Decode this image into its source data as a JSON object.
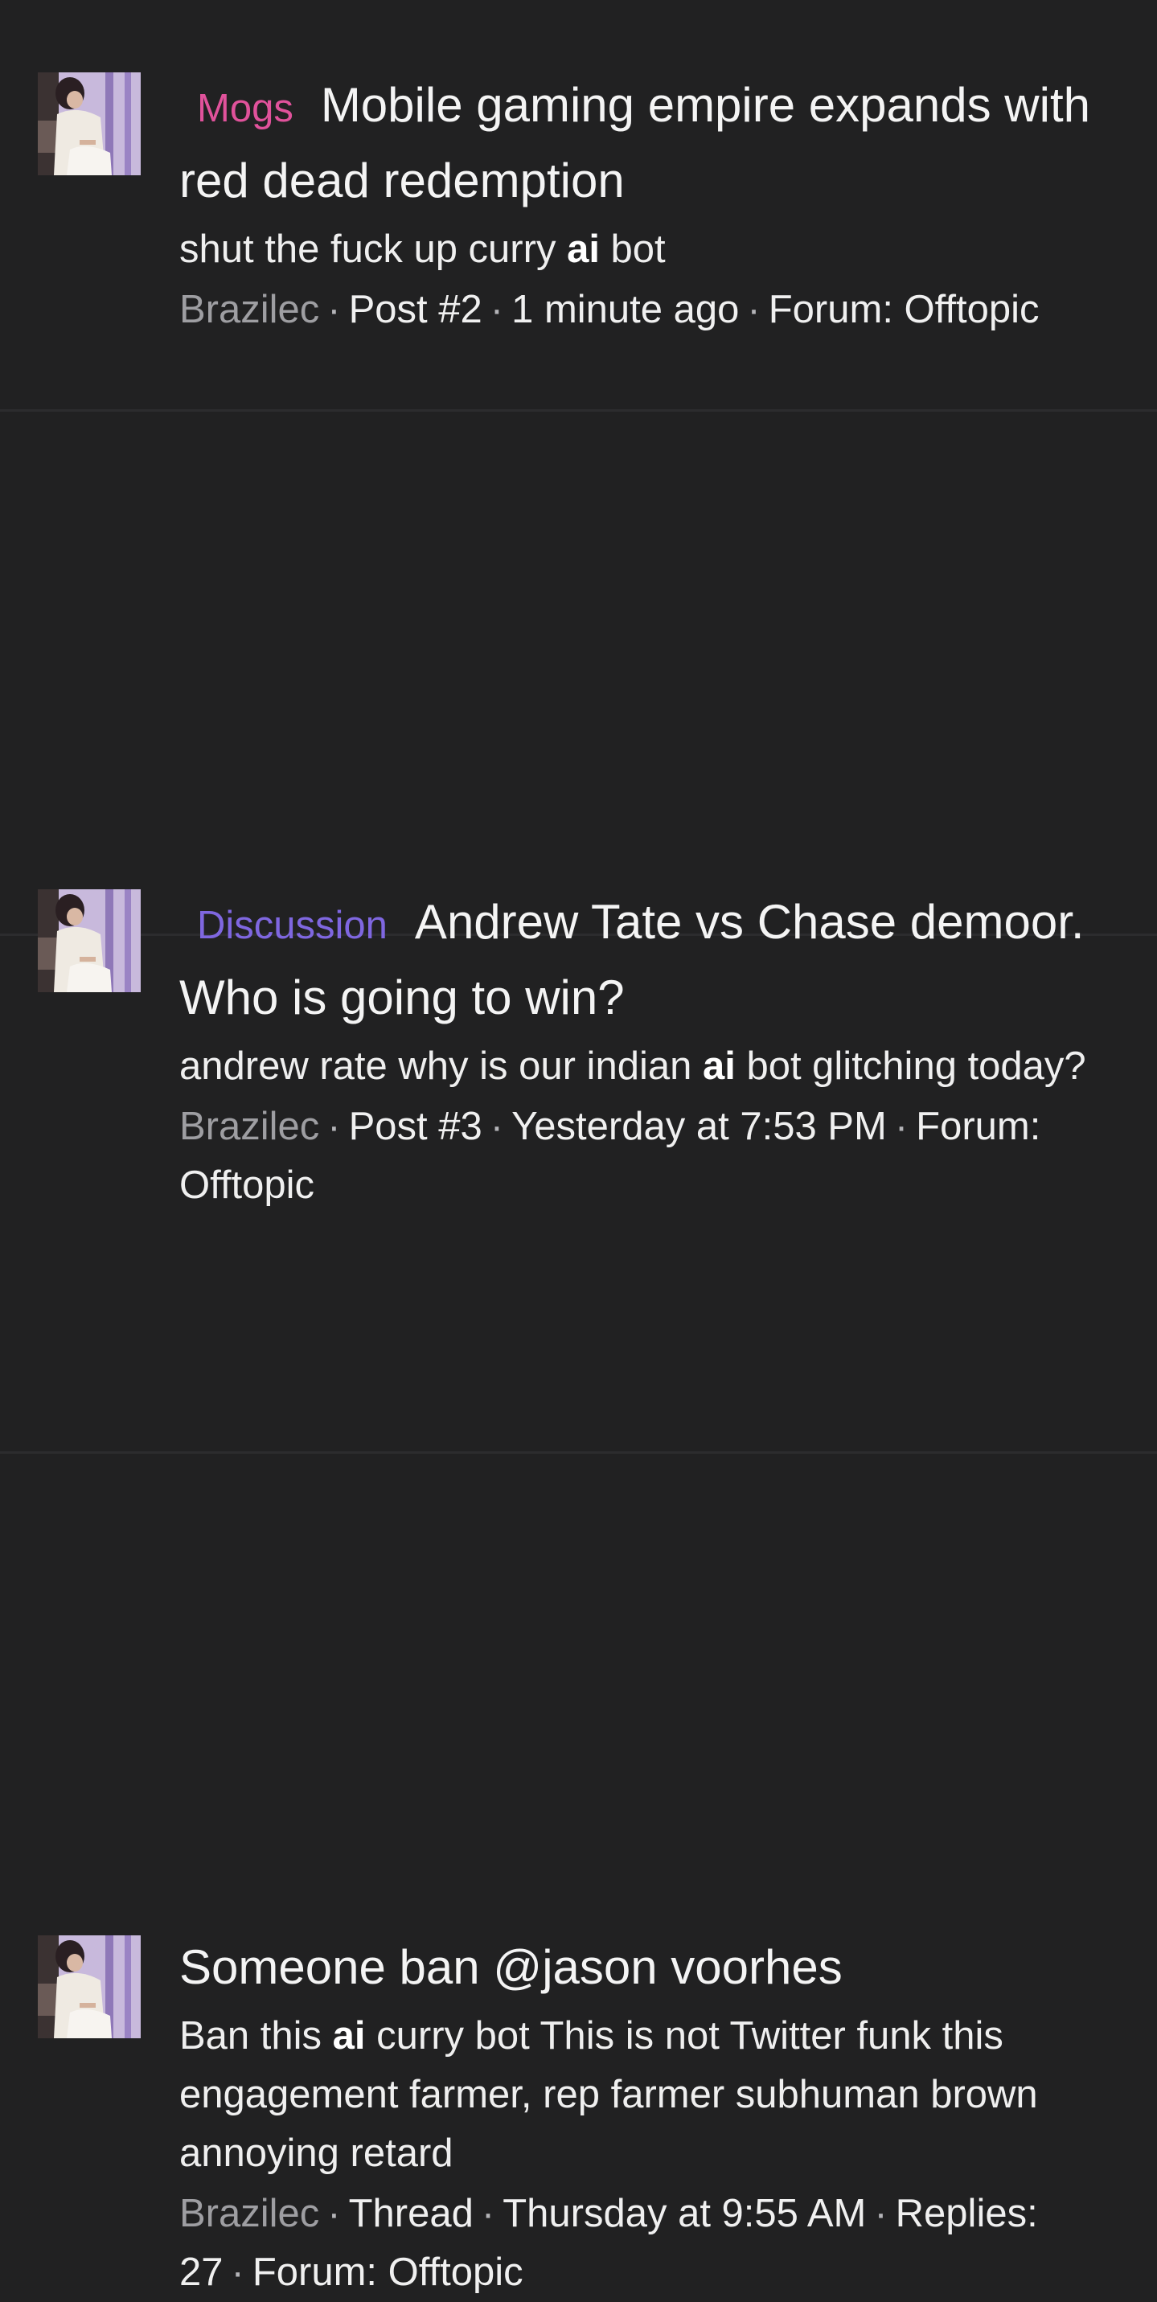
{
  "results": [
    {
      "prefix": "Mogs",
      "title": "Mobile gaming empire expands with red dead redemption",
      "snippet": {
        "before": "shut the fuck up curry ",
        "highlight": "ai",
        "after": " bot"
      },
      "meta": {
        "author": "Brazilec",
        "type": "Post #2",
        "time": "1 minute ago",
        "forum": "Forum: Offtopic"
      }
    },
    {
      "prefix": "Discussion",
      "title": "Andrew Tate vs Chase demoor. Who is going to win?",
      "snippet": {
        "before": "andrew rate why is our indian ",
        "highlight": "ai",
        "after": " bot glitching today?"
      },
      "meta": {
        "author": "Brazilec",
        "type": "Post #3",
        "time": "Yesterday at 7:53 PM",
        "forum": "Forum: Offtopic"
      }
    },
    {
      "prefix": "",
      "title": "Someone ban @jason voorhes",
      "snippet": {
        "before": "Ban this ",
        "highlight": "ai",
        "after": " curry bot This is not Twitter funk this engagement farmer, rep farmer subhuman brown annoying retard"
      },
      "meta": {
        "author": "Brazilec",
        "type": "Thread",
        "time": "Thursday at 9:55 AM",
        "replies": "Replies: 27",
        "forum": "Forum: Offtopic"
      }
    }
  ],
  "separator": "·",
  "colors": {
    "background": "#212122",
    "divider": "#2c2c2e",
    "prefix_mogs": "#e0529b",
    "prefix_discussion": "#7f67e0",
    "author": "#9e9ea2",
    "text": "#f2f2f2"
  }
}
